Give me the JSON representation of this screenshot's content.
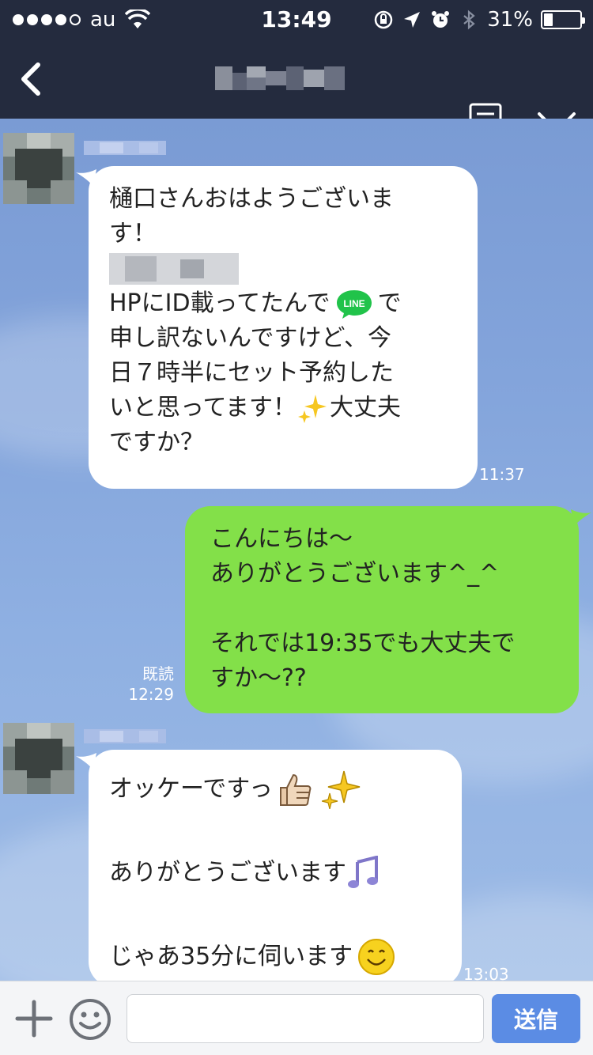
{
  "status_bar": {
    "signal_strength": 4,
    "carrier": "au",
    "time": "13:49",
    "battery_percent": "31%",
    "battery_level": 0.31,
    "icons": [
      "wifi-icon",
      "rotation-lock-icon",
      "location-icon",
      "alarm-icon",
      "bluetooth-icon",
      "battery-icon"
    ]
  },
  "header": {
    "title": "",
    "back_icon": "chevron-left-icon",
    "notes_icon": "notes-icon",
    "menu_icon": "chevron-down-icon"
  },
  "messages": [
    {
      "side": "left",
      "lines": [
        "樋口さんおはようございま",
        "す！",
        "",
        "HPにID載ってたんで",
        "申し訳ないんですけど、今",
        "日７時半にセット予約した",
        "いと思ってます！",
        "ですか？"
      ],
      "line3_trailing": "で",
      "line6_trailing": "大丈夫",
      "emoji_line": "line-logo-icon",
      "emoji_sparkle": "sparkles-icon",
      "time": "11:37"
    },
    {
      "side": "right",
      "lines": [
        "こんにちは〜",
        "ありがとうございます^_^",
        "",
        "それでは19:35でも大丈夫で",
        "すか〜??"
      ],
      "read_label": "既読",
      "time": "12:29"
    },
    {
      "side": "left",
      "lines": [
        "オッケーですっ",
        "",
        "ありがとうございます",
        "",
        "じゃあ35分に伺います"
      ],
      "emojis": [
        "thumbs-up-icon",
        "sparkles-icon",
        "music-note-icon",
        "smile-icon"
      ],
      "time": "13:03"
    }
  ],
  "input_bar": {
    "placeholder": "",
    "send_label": "送信"
  },
  "colors": {
    "nav_bg": "#242b3e",
    "chat_bg": "#83a4db",
    "sent_bubble": "#83e049",
    "received_bubble": "#ffffff",
    "send_button": "#5b8ce4"
  }
}
